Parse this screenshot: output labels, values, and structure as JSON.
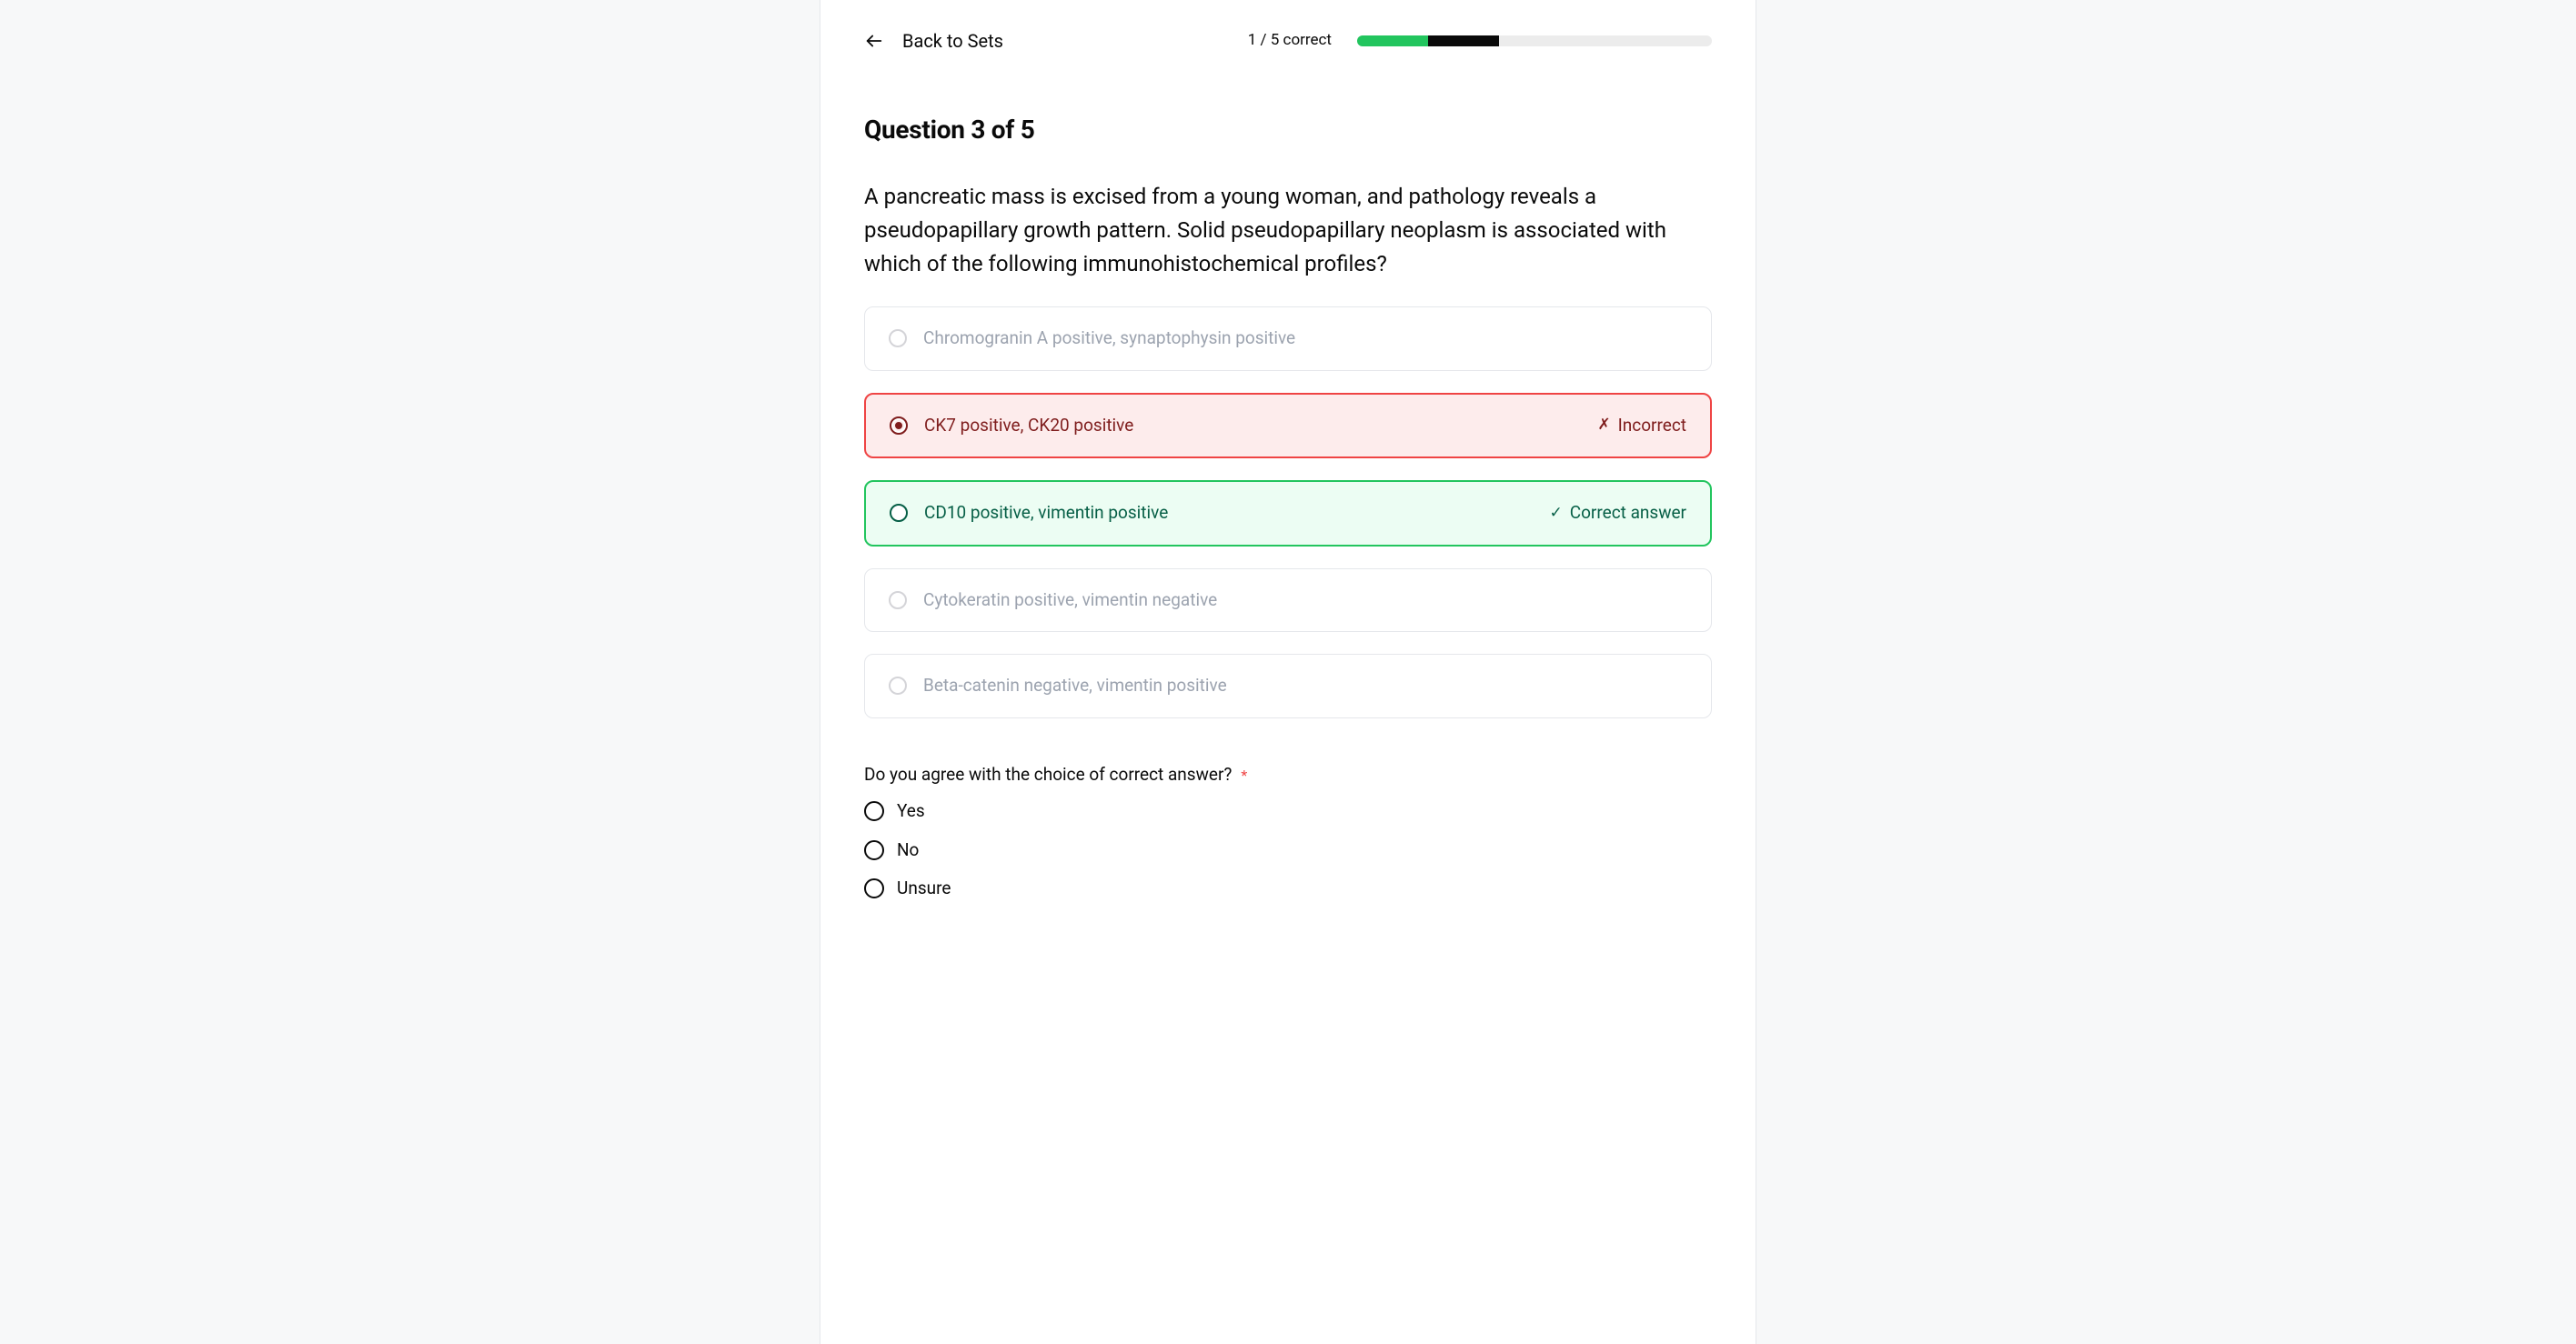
{
  "header": {
    "back_label": "Back to Sets",
    "progress_text": "1 / 5 correct",
    "segments": {
      "green_pct": 20,
      "black_pct": 20
    }
  },
  "question": {
    "heading": "Question 3 of 5",
    "prompt": "A pancreatic mass is excised from a young woman, and pathology reveals a pseudopapillary growth pattern. Solid pseudopapillary neoplasm is associated with which of the following immunohistochemical profiles?"
  },
  "status_labels": {
    "incorrect": "Incorrect",
    "correct": "Correct answer"
  },
  "answers": [
    {
      "label": "Chromogranin A positive, synaptophysin positive",
      "state": "neutral"
    },
    {
      "label": "CK7 positive, CK20 positive",
      "state": "incorrect"
    },
    {
      "label": "CD10 positive, vimentin positive",
      "state": "correct"
    },
    {
      "label": "Cytokeratin positive, vimentin negative",
      "state": "neutral"
    },
    {
      "label": "Beta-catenin negative, vimentin positive",
      "state": "neutral"
    }
  ],
  "agree": {
    "prompt": "Do you agree with the choice of correct answer?",
    "required_mark": "*",
    "options": [
      "Yes",
      "No",
      "Unsure"
    ]
  }
}
